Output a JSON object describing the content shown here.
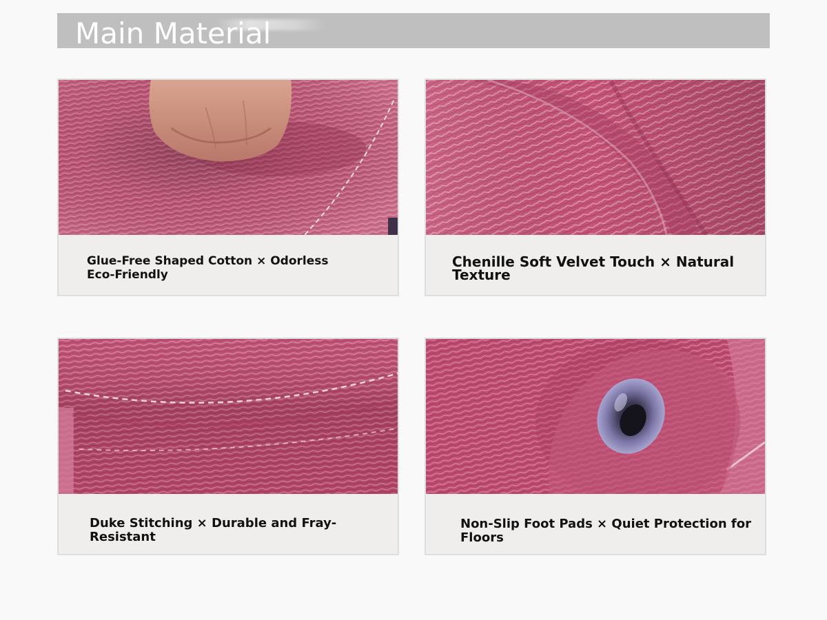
{
  "header": {
    "title": "Main Material"
  },
  "features": [
    {
      "caption": "Glue-Free Shaped Cotton × Odorless Eco-Friendly",
      "image": "fist-pressing-pink-cushion"
    },
    {
      "caption": "Chenille Soft Velvet Touch × Natural Texture",
      "image": "pink-chenille-fabric-closeup"
    },
    {
      "caption": "Duke Stitching × Durable and Fray-Resistant",
      "image": "stitched-pink-fabric-seam"
    },
    {
      "caption": "Non-Slip Foot Pads × Quiet Protection for Floors",
      "image": "clear-foot-pad-on-pink-fabric"
    }
  ],
  "colors": {
    "background": "#f9f9f9",
    "header_bar": "#bfbfbf",
    "header_text": "#ffffff",
    "card_background": "#efeeed",
    "fabric": "#c0506f",
    "caption_text": "#111111"
  }
}
